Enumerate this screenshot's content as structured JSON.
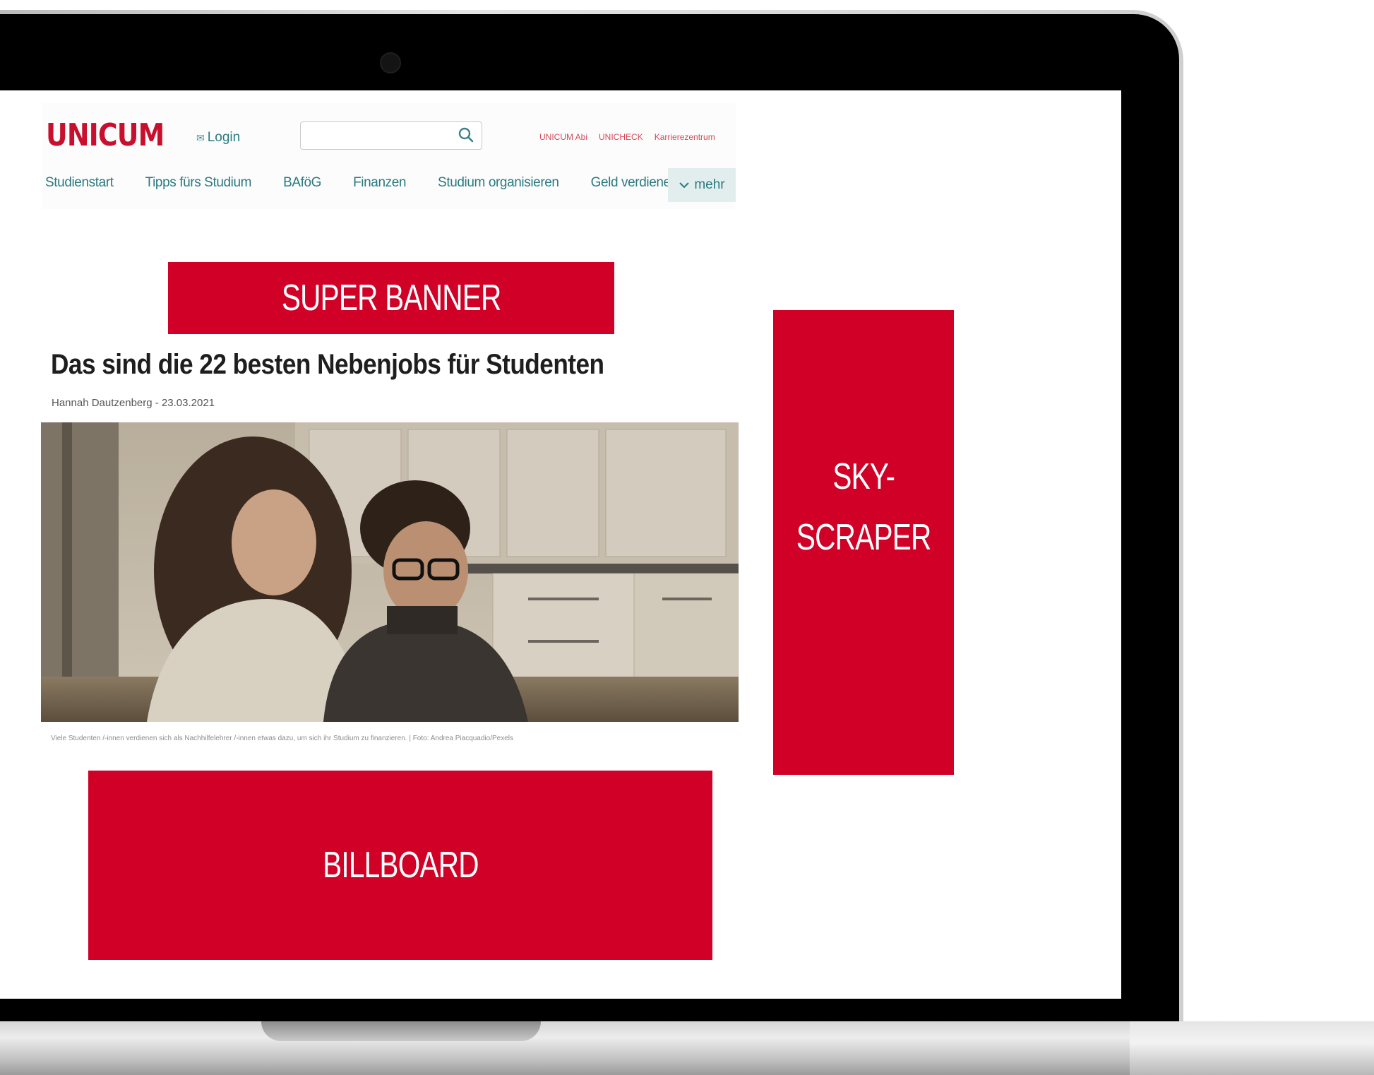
{
  "site": {
    "logo": "UNICUM",
    "login_label": "Login",
    "search": {
      "placeholder": ""
    },
    "top_links": [
      "UNICUM Abi",
      "UNICHECK",
      "Karrierezentrum"
    ],
    "nav": [
      "Studienstart",
      "Tipps fürs Studium",
      "BAföG",
      "Finanzen",
      "Studium organisieren",
      "Geld verdienen"
    ],
    "more_label": "mehr"
  },
  "ads": {
    "super_banner": "SUPER BANNER",
    "skyscraper_line1": "SKY-",
    "skyscraper_line2": "SCRAPER",
    "billboard": "BILLBOARD"
  },
  "article": {
    "headline": "Das sind die 22 besten Nebenjobs für Studenten",
    "byline": "Hannah Dautzenberg - 23.03.2021",
    "caption": "Viele Studenten /-innen verdienen sich als Nachhilfelehrer /-innen etwas dazu, um sich ihr Studium zu finanzieren. | Foto: Andrea Piacquadio/Pexels"
  },
  "colors": {
    "brand_red": "#c8102e",
    "ad_red": "#d00027",
    "nav_teal": "#2a7a80"
  },
  "icons": {
    "search": "search-icon",
    "login": "mail-icon",
    "more": "chevron-down-icon"
  }
}
